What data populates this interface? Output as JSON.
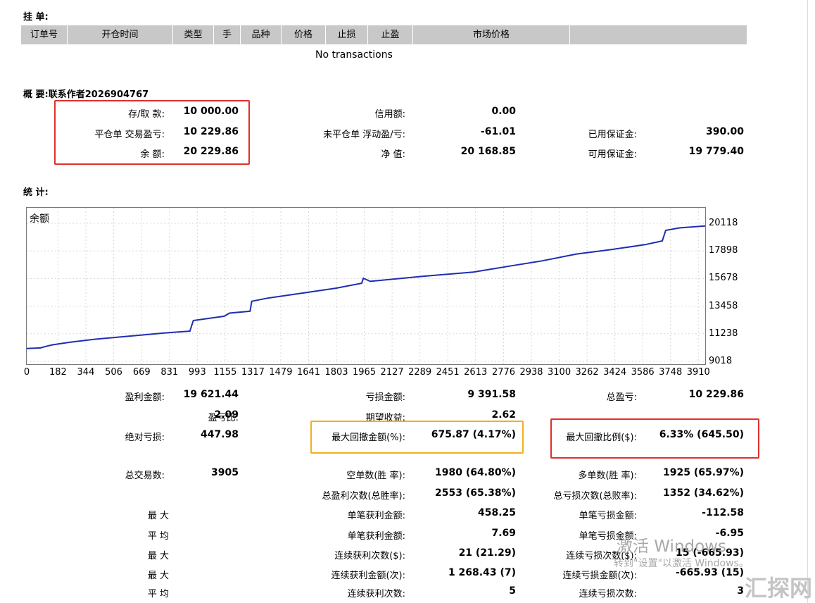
{
  "pending": {
    "title": "挂 单:",
    "columns": [
      "订单号",
      "开仓时间",
      "类型",
      "手",
      "品种",
      "价格",
      "止损",
      "止盈",
      "市场价格",
      ""
    ],
    "empty_text": "No transactions"
  },
  "summary": {
    "title": "概 要:联系作者2026904767",
    "deposit_label": "存/取 款:",
    "deposit_value": "10 000.00",
    "closed_pl_label": "平仓单 交易盈亏:",
    "closed_pl_value": "10 229.86",
    "balance_label": "余 额:",
    "balance_value": "20 229.86",
    "credit_label": "信用额:",
    "credit_value": "0.00",
    "floating_label": "未平仓单 浮动盈/亏:",
    "floating_value": "-61.01",
    "equity_label": "净 值:",
    "equity_value": "20 168.85",
    "margin_label": "已用保证金:",
    "margin_value": "390.00",
    "free_margin_label": "可用保证金:",
    "free_margin_value": "19 779.40"
  },
  "stats": {
    "title": "统 计:",
    "gross_profit_label": "盈利金额:",
    "gross_profit_value": "19 621.44",
    "gross_loss_label": "亏损金额:",
    "gross_loss_value": "9 391.58",
    "total_net_label": "总盈亏:",
    "total_net_value": "10 229.86",
    "profit_factor_label": "盈亏比:",
    "profit_factor_value": "2.09",
    "expected_payoff_label": "期望收益:",
    "expected_payoff_value": "2.62",
    "abs_drawdown_label": "绝对亏损:",
    "abs_drawdown_value": "447.98",
    "max_dd_amount_label": "最大回撤金额(%):",
    "max_dd_amount_value": "675.87 (4.17%)",
    "max_dd_ratio_label": "最大回撤比例($):",
    "max_dd_ratio_value": "6.33% (645.50)",
    "total_trades_label": "总交易数:",
    "total_trades_value": "3905",
    "short_label": "空单数(胜 率):",
    "short_value": "1980 (64.80%)",
    "long_label": "多单数(胜 率):",
    "long_value": "1925 (65.97%)",
    "profit_trades_label": "总盈利次数(总胜率):",
    "profit_trades_value": "2553 (65.38%)",
    "loss_trades_label": "总亏损次数(总败率):",
    "loss_trades_value": "1352 (34.62%)",
    "largest_label": "最 大",
    "largest_win_label": "单笔获利金额:",
    "largest_win_value": "458.25",
    "largest_loss_label": "单笔亏损金额:",
    "largest_loss_value": "-112.58",
    "average_label": "平 均",
    "avg_win_label": "单笔获利金额:",
    "avg_win_value": "7.69",
    "avg_loss_label": "单笔亏损金额:",
    "avg_loss_value": "-6.95",
    "max_label_1": "最 大",
    "consec_wins_label": "连续获利次数($):",
    "consec_wins_value": "21 (21.29)",
    "consec_losses_label": "连续亏损次数($):",
    "consec_losses_value": "15 (-665.93)",
    "max_label_2": "最 大",
    "consec_profit_label": "连续获利金额(次):",
    "consec_profit_value": "1 268.43 (7)",
    "consec_loss_amt_label": "连续亏损金额(次):",
    "consec_loss_amt_value": "-665.93 (15)",
    "avg_label_2": "平 均",
    "avg_consec_wins_label": "连续获利次数:",
    "avg_consec_wins_value": "5",
    "avg_consec_losses_label": "连续亏损次数:",
    "avg_consec_losses_value": "3"
  },
  "chart_data": {
    "type": "line",
    "title": "余额",
    "x_ticks": [
      "0",
      "182",
      "344",
      "506",
      "669",
      "831",
      "993",
      "1155",
      "1317",
      "1479",
      "1641",
      "1803",
      "1965",
      "2127",
      "2289",
      "2451",
      "2613",
      "2776",
      "2938",
      "3100",
      "3262",
      "3424",
      "3586",
      "3748",
      "3910"
    ],
    "y_ticks": [
      "20118",
      "17898",
      "15678",
      "13458",
      "11238",
      "9018"
    ],
    "ylim": [
      9018,
      20118
    ],
    "xlim": [
      0,
      3950
    ],
    "series": [
      {
        "x": [
          0,
          80,
          120,
          150,
          250,
          400,
          600,
          800,
          950,
          970,
          1150,
          1180,
          1300,
          1310,
          1400,
          1600,
          1800,
          1950,
          1960,
          2000,
          2300,
          2600,
          2800,
          3000,
          3200,
          3400,
          3600,
          3700,
          3720,
          3800,
          3950
        ],
        "y": [
          10050,
          10100,
          10250,
          10350,
          10550,
          10800,
          11050,
          11300,
          11450,
          12300,
          12650,
          12900,
          13050,
          13850,
          14100,
          14500,
          14900,
          15300,
          15700,
          15450,
          15850,
          16200,
          16650,
          17100,
          17650,
          18000,
          18400,
          18700,
          19550,
          19750,
          19900
        ],
        "color": "#1f2db0"
      }
    ]
  },
  "watermark": {
    "line1": "激活 Windows",
    "line2": "转到\"设置\"以激活 Windows。",
    "logo": "汇探网"
  }
}
